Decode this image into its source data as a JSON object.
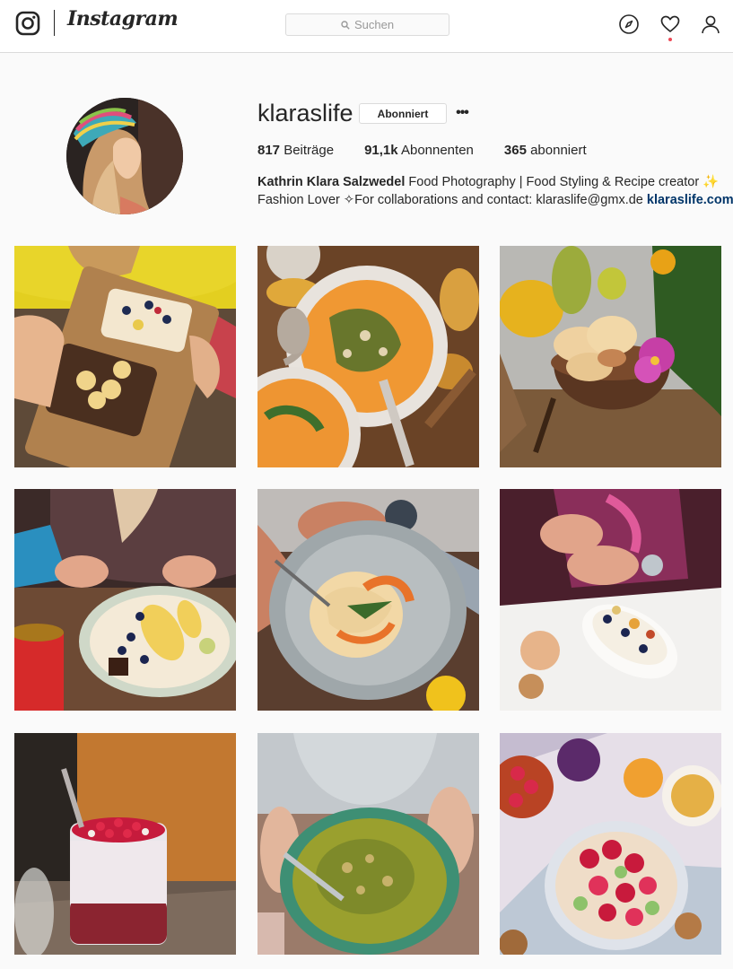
{
  "header": {
    "brand": "Instagram",
    "search_placeholder": "Suchen",
    "icons": [
      "instagram-glyph-icon",
      "compass-icon",
      "heart-icon",
      "person-icon",
      "search-icon"
    ]
  },
  "profile": {
    "username": "klaraslife",
    "follow_label": "Abonniert",
    "more_label": "•••",
    "stats": [
      {
        "value": "817",
        "label": "Beiträge"
      },
      {
        "value": "91,1k",
        "label": "Abonnenten"
      },
      {
        "value": "365",
        "label": "abonniert"
      }
    ],
    "bio": {
      "name": "Kathrin Klara Salzwedel",
      "line1_rest": " Food Photography | Food Styling & Recipe creator ✨",
      "line2": "Fashion Lover ✧For collaborations and contact: klaraslife@gmx.de ",
      "link": "klaraslife.com/en"
    }
  },
  "colors": {
    "accent": "#ed4956",
    "link": "#003569",
    "border": "#dbdbdb",
    "background": "#fafafa"
  },
  "posts": [
    {
      "id": "post-1",
      "subject": "toast-with-bananas"
    },
    {
      "id": "post-2",
      "subject": "pumpkin-soup"
    },
    {
      "id": "post-3",
      "subject": "coconut-bowl-with-flower"
    },
    {
      "id": "post-4",
      "subject": "oatmeal-bowl"
    },
    {
      "id": "post-5",
      "subject": "pasta-plate"
    },
    {
      "id": "post-6",
      "subject": "yogurt-boat"
    },
    {
      "id": "post-7",
      "subject": "chia-pudding-jar"
    },
    {
      "id": "post-8",
      "subject": "green-curry-bowl"
    },
    {
      "id": "post-9",
      "subject": "fruit-porridge"
    }
  ]
}
